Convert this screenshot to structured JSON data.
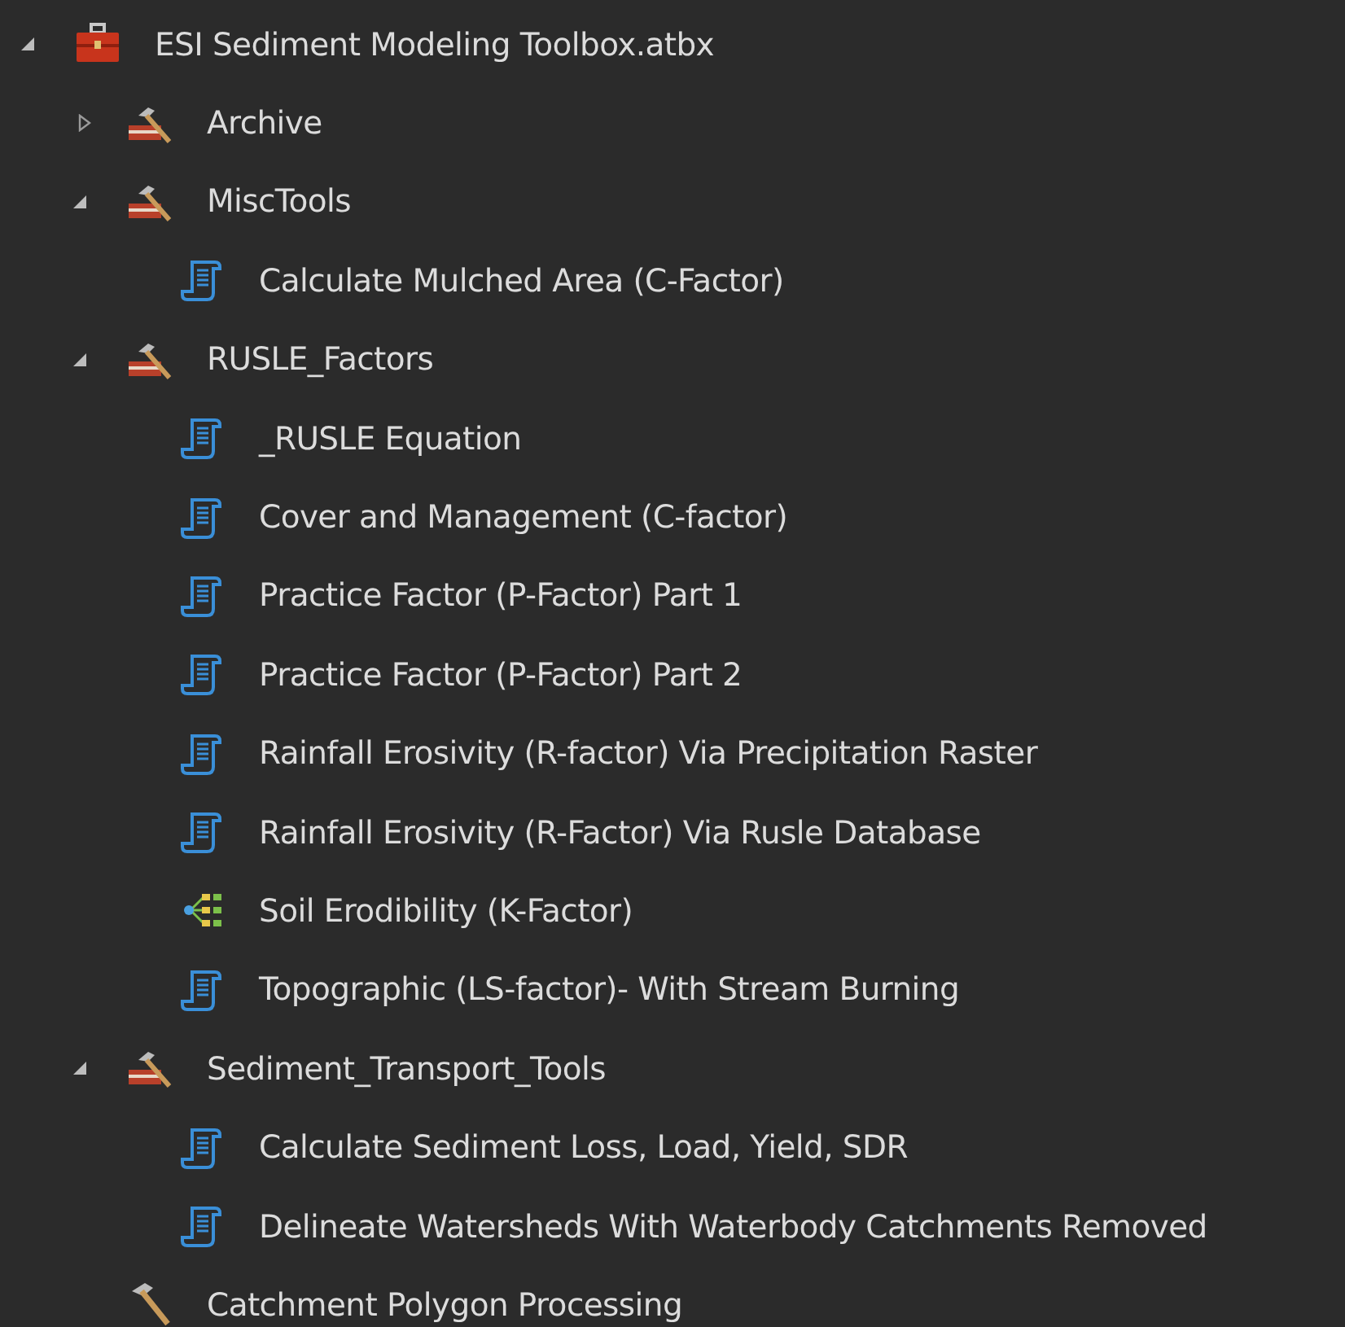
{
  "tree": [
    {
      "label": "ESI Sediment Modeling Toolbox.atbx",
      "kind": "toolbox",
      "expanded": true,
      "children": [
        {
          "label": "Archive",
          "kind": "toolset",
          "expanded": false
        },
        {
          "label": "MiscTools",
          "kind": "toolset",
          "expanded": true,
          "children": [
            {
              "label": "Calculate Mulched Area (C-Factor)",
              "kind": "script"
            }
          ]
        },
        {
          "label": "RUSLE_Factors",
          "kind": "toolset",
          "expanded": true,
          "children": [
            {
              "label": "_RUSLE Equation",
              "kind": "script"
            },
            {
              "label": "Cover and Management (C-factor)",
              "kind": "script"
            },
            {
              "label": "Practice Factor (P-Factor) Part 1",
              "kind": "script"
            },
            {
              "label": "Practice Factor (P-Factor) Part 2",
              "kind": "script"
            },
            {
              "label": "Rainfall Erosivity (R-factor) Via Precipitation Raster",
              "kind": "script"
            },
            {
              "label": "Rainfall Erosivity (R-Factor) Via Rusle Database",
              "kind": "script"
            },
            {
              "label": "Soil Erodibility (K-Factor)",
              "kind": "model"
            },
            {
              "label": "Topographic (LS-factor)- With Stream Burning",
              "kind": "script"
            }
          ]
        },
        {
          "label": "Sediment_Transport_Tools",
          "kind": "toolset",
          "expanded": true,
          "children": [
            {
              "label": "Calculate Sediment Loss, Load, Yield, SDR",
              "kind": "script"
            },
            {
              "label": "Delineate Watersheds With Waterbody Catchments Removed",
              "kind": "script"
            }
          ]
        },
        {
          "label": "Catchment Polygon Processing",
          "kind": "tool"
        }
      ]
    }
  ]
}
